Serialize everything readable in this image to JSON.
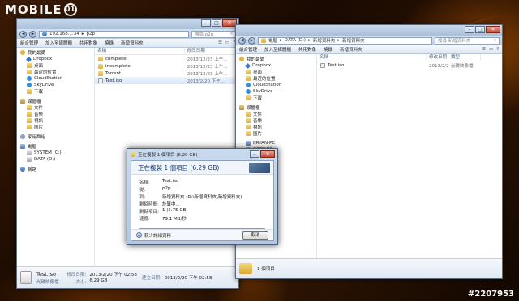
{
  "watermark": {
    "logo_text": "MOBILE",
    "logo_ring": "01",
    "image_id": "#2207953"
  },
  "left_window": {
    "address": [
      "192.168.1.34",
      "p2p"
    ],
    "search_placeholder": "搜尋 p2p",
    "toolbar": [
      "組合管理",
      "加入至媒體櫃",
      "共用對象",
      "燒錄",
      "新增資料夾"
    ],
    "columns": [
      "名稱",
      "修改日期"
    ],
    "sidebar": [
      {
        "label": "我的最愛",
        "icon": "star-icon",
        "level": 0
      },
      {
        "label": "Dropbox",
        "icon": "dropbox-icon",
        "level": 1
      },
      {
        "label": "桌面",
        "icon": "desktop-icon",
        "level": 1
      },
      {
        "label": "最近的位置",
        "icon": "recent-icon",
        "level": 1
      },
      {
        "label": "CloudStation",
        "icon": "cloud-icon",
        "level": 1
      },
      {
        "label": "SkyDrive",
        "icon": "cloud-icon",
        "level": 1
      },
      {
        "label": "下載",
        "icon": "download-icon",
        "level": 1
      },
      {
        "label": "媒體櫃",
        "icon": "library-icon",
        "level": 0,
        "gap": true
      },
      {
        "label": "文件",
        "icon": "documents-icon",
        "level": 1
      },
      {
        "label": "音樂",
        "icon": "music-icon",
        "level": 1
      },
      {
        "label": "視訊",
        "icon": "video-icon",
        "level": 1
      },
      {
        "label": "圖片",
        "icon": "pictures-icon",
        "level": 1
      },
      {
        "label": "家用群組",
        "icon": "homegroup-icon",
        "level": 0,
        "gap": true
      },
      {
        "label": "電腦",
        "icon": "computer-icon",
        "level": 0,
        "gap": true
      },
      {
        "label": "SYSTEM (C:)",
        "icon": "drive-icon",
        "level": 1
      },
      {
        "label": "DATA (D:)",
        "icon": "drive-icon",
        "level": 1
      },
      {
        "label": "網路",
        "icon": "network-icon",
        "level": 0,
        "gap": true
      }
    ],
    "files": [
      {
        "name": "complete",
        "date": "2013/12/23 上午...",
        "kind": "folder"
      },
      {
        "name": "incomplete",
        "date": "2013/12/23 上午...",
        "kind": "folder"
      },
      {
        "name": "Torrent",
        "date": "2013/12/23 上午...",
        "kind": "folder"
      },
      {
        "name": "Test.iso",
        "date": "2013/2/20 下午...",
        "kind": "file",
        "selected": true
      }
    ],
    "details": {
      "name": "Test.iso",
      "modified_label": "修改日期:",
      "modified": "2013/2/20 下午 02:58",
      "created_label": "建立日期:",
      "created": "2013/2/20 下午 02:58",
      "type": "光碟映像檔",
      "size_label": "大小:",
      "size": "6.29 GB"
    }
  },
  "right_window": {
    "address": [
      "電腦",
      "DATA (D:)",
      "新增資料夾",
      "新增資料夾"
    ],
    "search_placeholder": "搜尋 新增資料夾",
    "toolbar": [
      "組合管理",
      "加入至媒體櫃",
      "共用對象",
      "燒錄",
      "新增資料夾"
    ],
    "columns": [
      "名稱",
      "修改日期",
      "類型"
    ],
    "sidebar": [
      {
        "label": "我的最愛",
        "icon": "star-icon",
        "level": 0
      },
      {
        "label": "Dropbox",
        "icon": "dropbox-icon",
        "level": 1
      },
      {
        "label": "桌面",
        "icon": "desktop-icon",
        "level": 1
      },
      {
        "label": "最近的位置",
        "icon": "recent-icon",
        "level": 1
      },
      {
        "label": "CloudStation",
        "icon": "cloud-icon",
        "level": 1
      },
      {
        "label": "SkyDrive",
        "icon": "cloud-icon",
        "level": 1
      },
      {
        "label": "下載",
        "icon": "download-icon",
        "level": 1
      },
      {
        "label": "媒體櫃",
        "icon": "library-icon",
        "level": 0,
        "gap": true
      },
      {
        "label": "文件",
        "icon": "documents-icon",
        "level": 1
      },
      {
        "label": "音樂",
        "icon": "music-icon",
        "level": 1
      },
      {
        "label": "視訊",
        "icon": "video-icon",
        "level": 1
      },
      {
        "label": "圖片",
        "icon": "pictures-icon",
        "level": 1
      },
      {
        "label": "BRYAN-PC",
        "icon": "computer-icon",
        "level": 1,
        "gap": true
      },
      {
        "label": "CODY-PC",
        "icon": "computer-icon",
        "level": 1
      }
    ],
    "files": [
      {
        "name": "Test.iso",
        "date": "2013/2/20 下午...",
        "type": "光碟映像檔",
        "kind": "file"
      }
    ],
    "details": {
      "count": "1 個項目"
    }
  },
  "copy_dialog": {
    "title": "正在複製 1 個項目 (6.29 GB)",
    "heading": "正在複製 1 個項目 (6.29 GB)",
    "rows": [
      {
        "key": "名稱:",
        "value": "Test.iso"
      },
      {
        "key": "從:",
        "value": "p2p"
      },
      {
        "key": "到:",
        "value": "新增資料夾 (D:\\新增資料夾\\新增資料夾)"
      },
      {
        "key": "剩餘時間:",
        "value": "計算中..."
      },
      {
        "key": "剩餘項目:",
        "value": "1 (5.75 GB)"
      },
      {
        "key": "速度:",
        "value": "79.1 MB/秒"
      }
    ],
    "progress": 0.09,
    "less_details": "較少詳細資料",
    "cancel": "取消"
  }
}
